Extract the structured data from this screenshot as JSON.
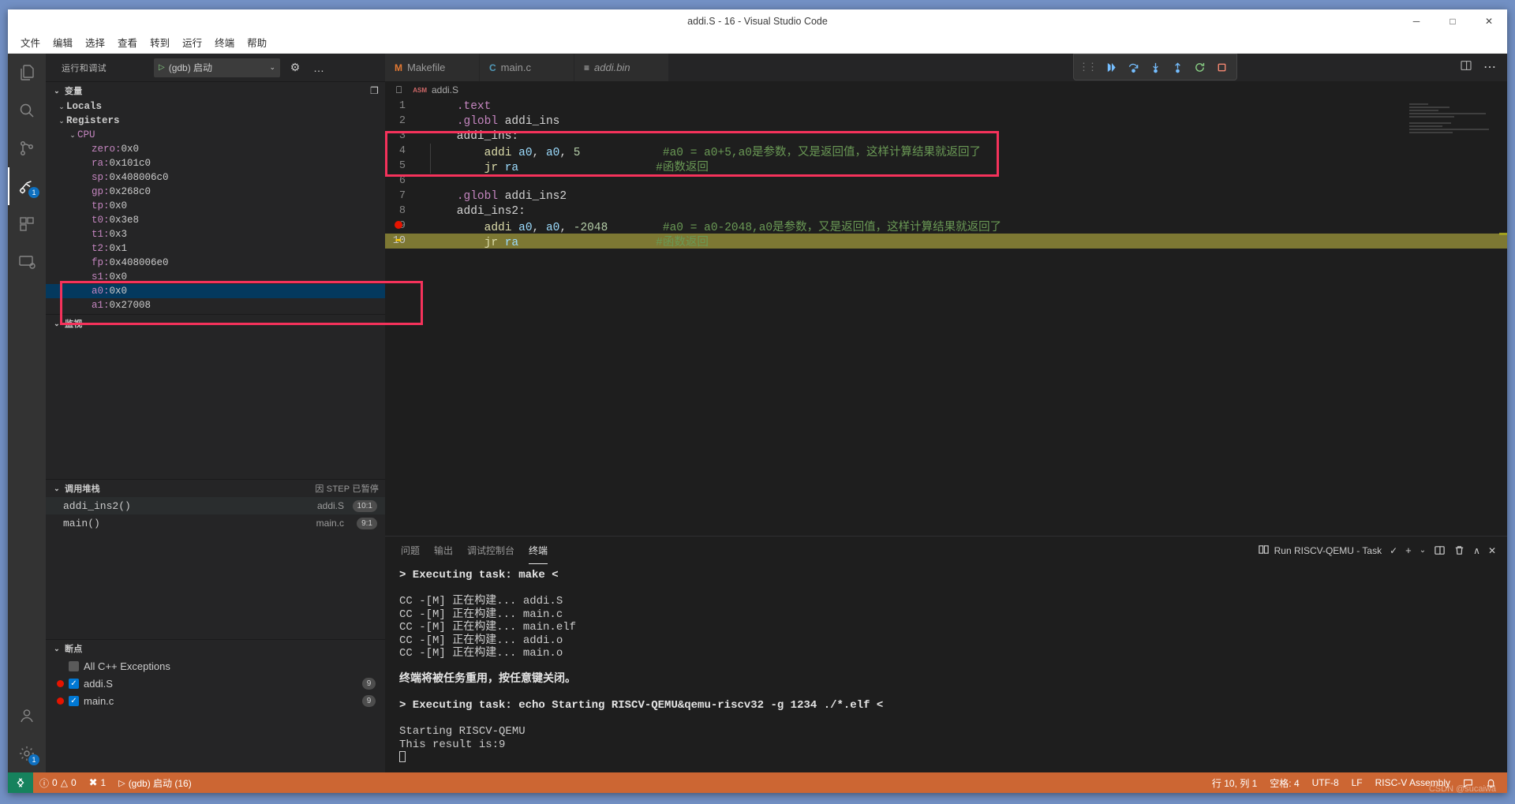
{
  "window": {
    "title": "addi.S - 16 - Visual Studio Code",
    "minimize": "─",
    "maximize": "□",
    "close": "✕"
  },
  "menubar": {
    "items": [
      {
        "label": "文件",
        "name": "menu-file"
      },
      {
        "label": "编辑",
        "name": "menu-edit"
      },
      {
        "label": "选择",
        "name": "menu-selection"
      },
      {
        "label": "查看",
        "name": "menu-view"
      },
      {
        "label": "转到",
        "name": "menu-go"
      },
      {
        "label": "运行",
        "name": "menu-run"
      },
      {
        "label": "终端",
        "name": "menu-terminal"
      },
      {
        "label": "帮助",
        "name": "menu-help"
      }
    ]
  },
  "activitybar": {
    "items": [
      {
        "icon": "explorer-icon",
        "active": false
      },
      {
        "icon": "search-icon",
        "active": false
      },
      {
        "icon": "source-control-icon",
        "active": false
      },
      {
        "icon": "run-and-debug-icon",
        "active": true,
        "badge": "1"
      },
      {
        "icon": "extensions-icon",
        "active": false
      },
      {
        "icon": "remote-explorer-icon",
        "active": false
      }
    ],
    "bottom": [
      {
        "icon": "account-icon",
        "badge": ""
      },
      {
        "icon": "settings-gear-icon",
        "badge": "1"
      }
    ]
  },
  "sidebar": {
    "title": "运行和调试",
    "config_label": "(gdb) 启动",
    "config_play": "▷",
    "config_chevron": "⌄",
    "gear_icon": "⚙",
    "more_icon": "…",
    "variables": {
      "header": "变量",
      "caret": "⌄",
      "filter_icon": "❐",
      "nodes": [
        {
          "label": "Locals",
          "type": "group",
          "indent": 1
        },
        {
          "label": "Registers",
          "type": "group",
          "indent": 1
        },
        {
          "label": "CPU",
          "type": "cpu",
          "indent": 2
        }
      ],
      "registers": [
        {
          "name": "zero",
          "value": "0x0"
        },
        {
          "name": "ra",
          "value": "0x101c0"
        },
        {
          "name": "sp",
          "value": "0x408006c0"
        },
        {
          "name": "gp",
          "value": "0x268c0"
        },
        {
          "name": "tp",
          "value": "0x0"
        },
        {
          "name": "t0",
          "value": "0x3e8"
        },
        {
          "name": "t1",
          "value": "0x3"
        },
        {
          "name": "t2",
          "value": "0x1"
        },
        {
          "name": "fp",
          "value": "0x408006e0"
        },
        {
          "name": "s1",
          "value": "0x0"
        },
        {
          "name": "a0",
          "value": "0x0",
          "selected": true
        },
        {
          "name": "a1",
          "value": "0x27008"
        }
      ]
    },
    "watch": {
      "header": "监视",
      "caret": "⌄"
    },
    "callstack": {
      "header": "调用堆栈",
      "caret": "⌄",
      "pause_reason": "因 STEP 已暂停",
      "pause_icon": "▮▮",
      "frames": [
        {
          "label": "addi_ins2()",
          "file": "addi.S",
          "pos": "10:1",
          "active": true
        },
        {
          "label": "main()",
          "file": "main.c",
          "pos": "9:1",
          "active": false
        }
      ]
    },
    "breakpoints": {
      "header": "断点",
      "caret": "⌄",
      "items": [
        {
          "label": "All C++ Exceptions",
          "checked": false,
          "dot": false,
          "count": ""
        },
        {
          "label": "addi.S",
          "checked": true,
          "dot": true,
          "count": "9"
        },
        {
          "label": "main.c",
          "checked": true,
          "dot": true,
          "count": "9"
        }
      ],
      "check_glyph": "✓"
    }
  },
  "tabs": [
    {
      "label": "Makefile",
      "icon": "M",
      "icon_kind": "m",
      "italic": false,
      "active": false
    },
    {
      "label": "main.c",
      "icon": "C",
      "icon_kind": "c",
      "italic": false,
      "active": false
    },
    {
      "label": "addi.bin",
      "icon": "≡",
      "icon_kind": "b",
      "italic": true,
      "active": false
    }
  ],
  "debug_toolbar": {
    "grip": "⋮⋮",
    "buttons": [
      {
        "name": "continue-button",
        "icon": "continue-icon"
      },
      {
        "name": "step-over-button",
        "icon": "step-over-icon"
      },
      {
        "name": "step-into-button",
        "icon": "step-into-icon"
      },
      {
        "name": "step-out-button",
        "icon": "step-out-icon"
      },
      {
        "name": "restart-button",
        "icon": "restart-icon"
      },
      {
        "name": "stop-button",
        "icon": "stop-icon"
      }
    ]
  },
  "editor_actions": {
    "split_icon": "split-editor-icon",
    "more_icon": "more-actions-icon"
  },
  "breadcrumb": {
    "asm_badge": "ASM",
    "file": "addi.S"
  },
  "code": {
    "lines": [
      {
        "n": "1",
        "tokens": [
          {
            "t": "    ",
            "c": "plain"
          },
          {
            "t": ".text",
            "c": "dir"
          }
        ]
      },
      {
        "n": "2",
        "tokens": [
          {
            "t": "    ",
            "c": "plain"
          },
          {
            "t": ".globl",
            "c": "dir"
          },
          {
            "t": " addi_ins",
            "c": "plain"
          }
        ]
      },
      {
        "n": "3",
        "tokens": [
          {
            "t": "    addi_ins:",
            "c": "plain"
          }
        ]
      },
      {
        "n": "4",
        "tokens": [
          {
            "t": "        ",
            "c": "plain"
          },
          {
            "t": "addi",
            "c": "ins"
          },
          {
            "t": " ",
            "c": "plain"
          },
          {
            "t": "a0",
            "c": "reg2"
          },
          {
            "t": ", ",
            "c": "plain"
          },
          {
            "t": "a0",
            "c": "reg2"
          },
          {
            "t": ", ",
            "c": "plain"
          },
          {
            "t": "5",
            "c": "num"
          },
          {
            "t": "            ",
            "c": "plain"
          },
          {
            "t": "#a0 = a0+5,a0是参数，又是返回值，这样计算结果就返回了",
            "c": "cmt"
          }
        ]
      },
      {
        "n": "5",
        "tokens": [
          {
            "t": "        ",
            "c": "plain"
          },
          {
            "t": "jr",
            "c": "ins"
          },
          {
            "t": " ",
            "c": "plain"
          },
          {
            "t": "ra",
            "c": "reg2"
          },
          {
            "t": "                    ",
            "c": "plain"
          },
          {
            "t": "#函数返回",
            "c": "cmt"
          }
        ]
      },
      {
        "n": "6",
        "tokens": [
          {
            "t": "",
            "c": "plain"
          }
        ]
      },
      {
        "n": "7",
        "tokens": [
          {
            "t": "    ",
            "c": "plain"
          },
          {
            "t": ".globl",
            "c": "dir"
          },
          {
            "t": " addi_ins2",
            "c": "plain"
          }
        ]
      },
      {
        "n": "8",
        "tokens": [
          {
            "t": "    addi_ins2:",
            "c": "plain"
          }
        ]
      },
      {
        "n": "9",
        "breakpoint": true,
        "tokens": [
          {
            "t": "        ",
            "c": "plain"
          },
          {
            "t": "addi",
            "c": "ins"
          },
          {
            "t": " ",
            "c": "plain"
          },
          {
            "t": "a0",
            "c": "reg2"
          },
          {
            "t": ", ",
            "c": "plain"
          },
          {
            "t": "a0",
            "c": "reg2"
          },
          {
            "t": ", ",
            "c": "plain"
          },
          {
            "t": "-2048",
            "c": "num"
          },
          {
            "t": "        ",
            "c": "plain"
          },
          {
            "t": "#a0 = a0-2048,a0是参数，又是返回值，这样计算结果就返回了",
            "c": "cmt"
          }
        ]
      },
      {
        "n": "10",
        "current": true,
        "arrow": true,
        "tokens": [
          {
            "t": "        ",
            "c": "plain"
          },
          {
            "t": "jr",
            "c": "ins"
          },
          {
            "t": " ",
            "c": "plain"
          },
          {
            "t": "ra",
            "c": "reg2"
          },
          {
            "t": "                    ",
            "c": "plain"
          },
          {
            "t": "#函数返回",
            "c": "cmt"
          }
        ]
      }
    ]
  },
  "panel": {
    "tabs": [
      {
        "label": "问题",
        "active": false
      },
      {
        "label": "输出",
        "active": false
      },
      {
        "label": "调试控制台",
        "active": false
      },
      {
        "label": "终端",
        "active": true
      }
    ],
    "task_label": "Run RISCV-QEMU - Task",
    "task_icon": "terminal-split-icon",
    "check_icon": "✓",
    "add_icon": "➕",
    "add_chevron": "⌄",
    "split_icon": "◫",
    "kill_icon": "trash-icon",
    "chevron_up_icon": "∧",
    "close_icon": "✕",
    "terminal_lines": [
      {
        "text": "> Executing task: make <",
        "bold": true
      },
      {
        "text": "",
        "bold": false
      },
      {
        "text": "CC -[M] 正在构建... addi.S",
        "bold": false
      },
      {
        "text": "CC -[M] 正在构建... main.c",
        "bold": false
      },
      {
        "text": "CC -[M] 正在构建... main.elf",
        "bold": false
      },
      {
        "text": "CC -[M] 正在构建... addi.o",
        "bold": false
      },
      {
        "text": "CC -[M] 正在构建... main.o",
        "bold": false
      },
      {
        "text": "",
        "bold": false
      },
      {
        "text": "终端将被任务重用，按任意键关闭。",
        "bold": true
      },
      {
        "text": "",
        "bold": false
      },
      {
        "text": "> Executing task: echo Starting RISCV-QEMU&qemu-riscv32 -g 1234 ./*.elf <",
        "bold": true
      },
      {
        "text": "",
        "bold": false
      },
      {
        "text": "Starting RISCV-QEMU",
        "bold": false
      },
      {
        "text": "This result is:9",
        "bold": false
      }
    ]
  },
  "statusbar": {
    "remote_icon": "remote-window-icon",
    "left": [
      {
        "name": "problems-status",
        "icon": "⊗",
        "label": "0",
        "icon2": "⚠",
        "label2": "0"
      },
      {
        "name": "ports-status",
        "icon": "✂",
        "label": "1"
      },
      {
        "name": "debug-status",
        "icon": "▷",
        "label": "(gdb) 启动 (16)"
      }
    ],
    "right": [
      {
        "name": "cursor-position-status",
        "label": "行 10, 列 1"
      },
      {
        "name": "indentation-status",
        "label": "空格: 4"
      },
      {
        "name": "encoding-status",
        "label": "UTF-8"
      },
      {
        "name": "eol-status",
        "label": "LF"
      },
      {
        "name": "language-mode-status",
        "label": "RISC-V Assembly"
      },
      {
        "name": "feedback-status",
        "label": "☺"
      },
      {
        "name": "notifications-status",
        "label": "🔔"
      }
    ],
    "watermark": "CSDN @sucaiwa"
  },
  "colors": {
    "accent_red_box": "#f5325b",
    "status_bar": "#cc6633",
    "selection_blue": "#04395e",
    "current_line": "#7d7833",
    "breakpoint_red": "#e51400"
  }
}
